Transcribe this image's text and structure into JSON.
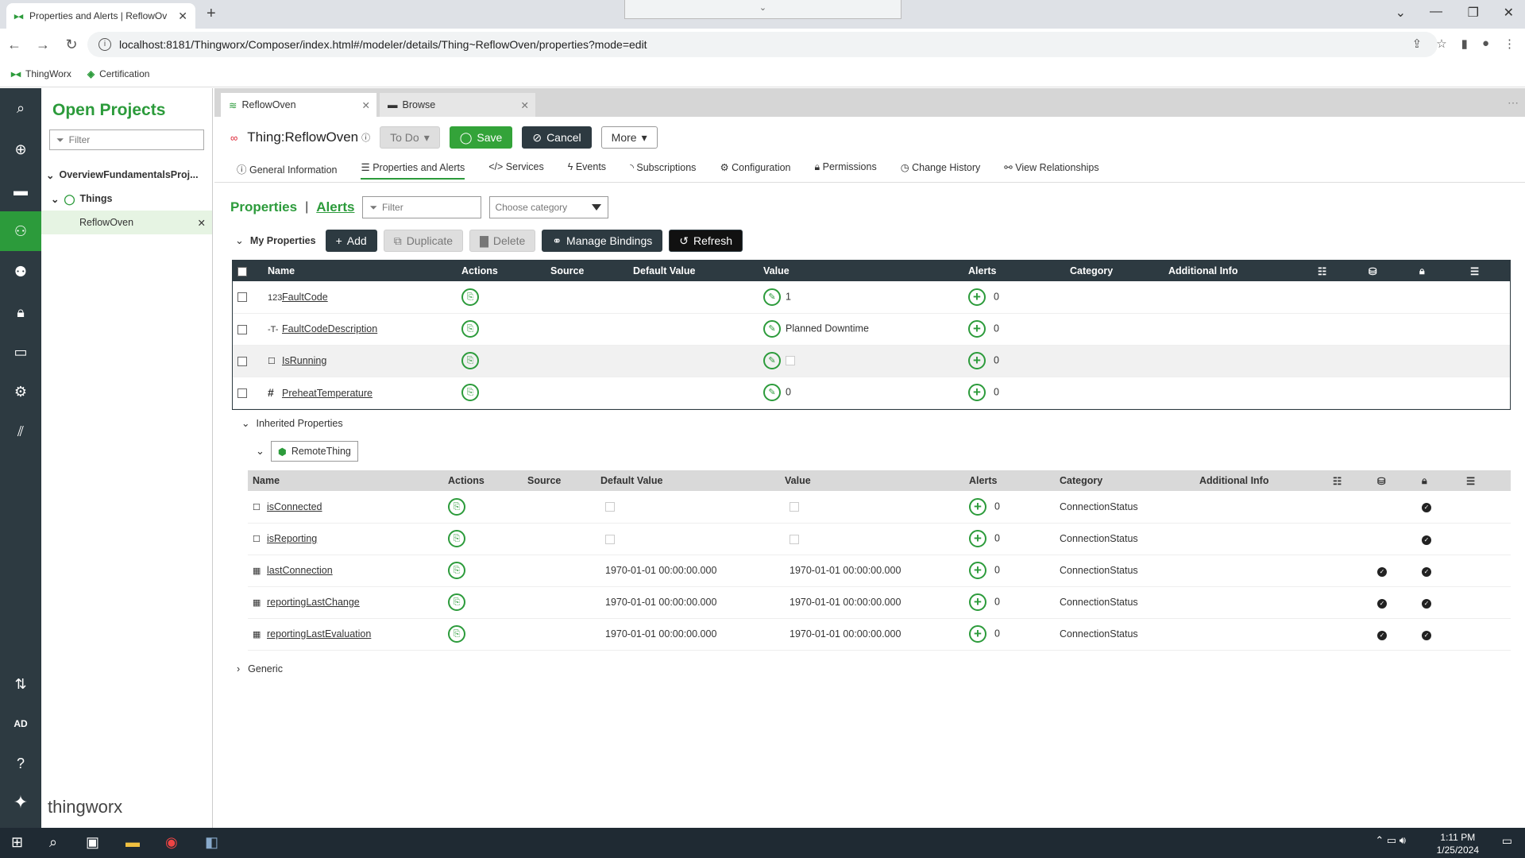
{
  "browser": {
    "tab_title": "Properties and Alerts | ReflowOv",
    "url": "localhost:8181/Thingworx/Composer/index.html#/modeler/details/Thing~ReflowOven/properties?mode=edit",
    "bookmarks": [
      {
        "label": "ThingWorx"
      },
      {
        "label": "Certification"
      }
    ]
  },
  "projects": {
    "title": "Open Projects",
    "filter_placeholder": "Filter",
    "project_name": "OverviewFundamentalsProj...",
    "group_label": "Things",
    "item_label": "ReflowOven"
  },
  "brand": "thingworx",
  "editor_tabs": [
    {
      "label": "ReflowOven"
    },
    {
      "label": "Browse"
    }
  ],
  "thing": {
    "title": "Thing:ReflowOven",
    "todo_label": "To Do",
    "save_label": "Save",
    "cancel_label": "Cancel",
    "more_label": "More"
  },
  "subnav": [
    {
      "label": "General Information"
    },
    {
      "label": "Properties and Alerts"
    },
    {
      "label": "Services"
    },
    {
      "label": "Events"
    },
    {
      "label": "Subscriptions"
    },
    {
      "label": "Configuration"
    },
    {
      "label": "Permissions"
    },
    {
      "label": "Change History"
    },
    {
      "label": "View Relationships"
    }
  ],
  "props_bar": {
    "properties_label": "Properties",
    "separator": "|",
    "alerts_label": "Alerts",
    "filter_placeholder": "Filter",
    "category_placeholder": "Choose category"
  },
  "my_properties": {
    "label": "My Properties",
    "add_label": "Add",
    "duplicate_label": "Duplicate",
    "delete_label": "Delete",
    "manage_bindings_label": "Manage Bindings",
    "refresh_label": "Refresh"
  },
  "columns": {
    "name": "Name",
    "actions": "Actions",
    "source": "Source",
    "default_value": "Default Value",
    "value": "Value",
    "alerts": "Alerts",
    "category": "Category",
    "additional_info": "Additional Info"
  },
  "own_properties": [
    {
      "type_glyph": "123",
      "name": "FaultCode",
      "value": "1",
      "alerts": "0"
    },
    {
      "type_glyph": "-T-",
      "name": "FaultCodeDescription",
      "value": "Planned Downtime",
      "alerts": "0"
    },
    {
      "type_glyph": "☐",
      "name": "IsRunning",
      "value": "",
      "alerts": "0"
    },
    {
      "type_glyph": "#",
      "name": "PreheatTemperature",
      "value": "0",
      "alerts": "0"
    }
  ],
  "inherited": {
    "label": "Inherited Properties",
    "template_name": "RemoteThing",
    "rows": [
      {
        "name": "isConnected",
        "default_value": "",
        "value": "",
        "alerts": "0",
        "category": "ConnectionStatus"
      },
      {
        "name": "isReporting",
        "default_value": "",
        "value": "",
        "alerts": "0",
        "category": "ConnectionStatus"
      },
      {
        "name": "lastConnection",
        "default_value": "1970-01-01 00:00:00.000",
        "value": "1970-01-01 00:00:00.000",
        "alerts": "0",
        "category": "ConnectionStatus"
      },
      {
        "name": "reportingLastChange",
        "default_value": "1970-01-01 00:00:00.000",
        "value": "1970-01-01 00:00:00.000",
        "alerts": "0",
        "category": "ConnectionStatus"
      },
      {
        "name": "reportingLastEvaluation",
        "default_value": "1970-01-01 00:00:00.000",
        "value": "1970-01-01 00:00:00.000",
        "alerts": "0",
        "category": "ConnectionStatus"
      }
    ]
  },
  "generic_label": "Generic",
  "taskbar": {
    "time": "1:11 PM",
    "date": "1/25/2024"
  },
  "colors": {
    "accent": "#2c9b3b",
    "rail": "#2d3a41"
  }
}
